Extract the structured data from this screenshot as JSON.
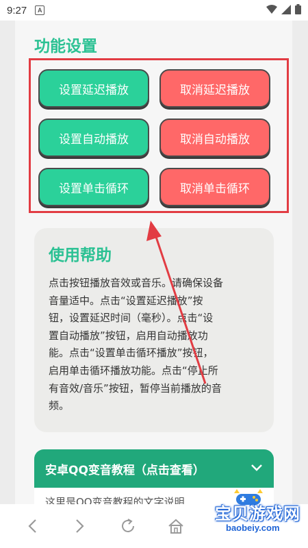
{
  "status_bar": {
    "time": "9:27",
    "notification_glyph": "A",
    "icons": [
      "wifi-icon",
      "signal-icon",
      "battery-icon"
    ]
  },
  "section": {
    "title": "功能设置"
  },
  "buttons": {
    "set_delay": "设置延迟播放",
    "cancel_delay": "取消延迟播放",
    "set_autoplay": "设置自动播放",
    "cancel_autoplay": "取消自动播放",
    "set_loop": "设置单击循环",
    "cancel_loop": "取消单击循环"
  },
  "help": {
    "title": "使用帮助",
    "lines": [
      "点击按钮播放音效或音乐。请确保设备",
      "音量适中。点击“设置延迟播放”按",
      "钮，设置延迟时间（毫秒）。点击“设",
      "置自动播放”按钮，启用自动播放功",
      "能。点击“设置单击循环播放”按钮，",
      "启用单击循环播放功能。点击“停止所",
      "有音效/音乐”按钮，暂停当前播放的音",
      "频。"
    ]
  },
  "tutorial": {
    "title": "安卓QQ变音教程（点击查看）",
    "body": "这里是QQ变音教程的文字说明"
  },
  "watermark": {
    "text": "宝贝游戏网",
    "url": "baobeiy.com"
  },
  "colors": {
    "accent_green": "#2bc193",
    "button_green": "#2bd19a",
    "button_red": "#ff6868",
    "highlight_red": "#e23c43",
    "tutorial_green": "#21a87b"
  }
}
